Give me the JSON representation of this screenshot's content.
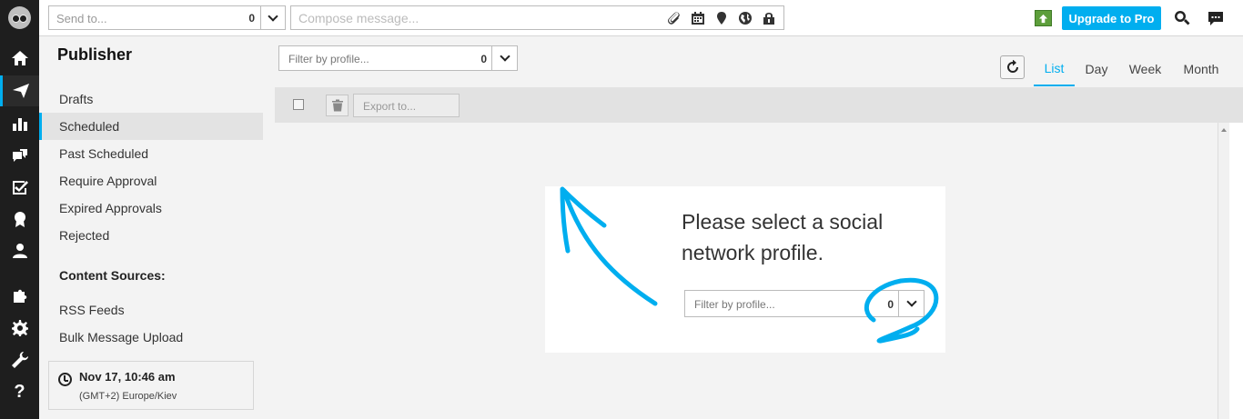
{
  "topbar": {
    "send_to_placeholder": "Send to...",
    "send_to_count": "0",
    "compose_placeholder": "Compose message...",
    "upgrade_label": "Upgrade to Pro"
  },
  "sidebar": {
    "title": "Publisher",
    "items": [
      {
        "label": "Drafts"
      },
      {
        "label": "Scheduled"
      },
      {
        "label": "Past Scheduled"
      },
      {
        "label": "Require Approval"
      },
      {
        "label": "Expired Approvals"
      },
      {
        "label": "Rejected"
      }
    ],
    "sources_heading": "Content Sources:",
    "sources": [
      {
        "label": "RSS Feeds"
      },
      {
        "label": "Bulk Message Upload"
      }
    ],
    "clock": {
      "datetime": "Nov 17, 10:46 am",
      "timezone": "(GMT+2) Europe/Kiev"
    }
  },
  "main": {
    "filter_placeholder": "Filter by profile...",
    "filter_count": "0",
    "views": [
      "List",
      "Day",
      "Week",
      "Month"
    ],
    "active_view": "List",
    "export_label": "Export to...",
    "empty_message": "Please select a social network profile.",
    "card_filter_placeholder": "Filter by profile...",
    "card_filter_count": "0"
  },
  "colors": {
    "accent": "#00aeef",
    "rail": "#1e1e1e",
    "upgrade_icon": "#5d9e3b"
  }
}
